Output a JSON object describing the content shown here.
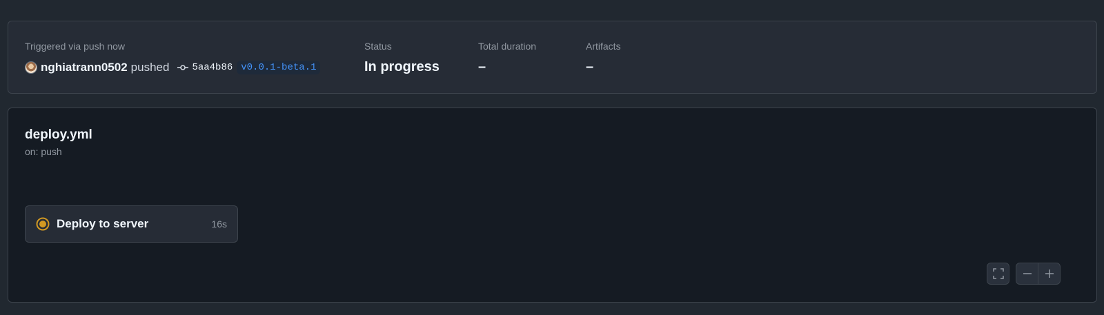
{
  "summary": {
    "trigger_label": "Triggered via push now",
    "user": "nghiatrann0502",
    "action": "pushed",
    "commit_sha": "5aa4b86",
    "tag": "v0.0.1-beta.1",
    "status_label": "Status",
    "status_value": "In progress",
    "duration_label": "Total duration",
    "duration_value": "–",
    "artifacts_label": "Artifacts",
    "artifacts_value": "–"
  },
  "workflow": {
    "name": "deploy.yml",
    "trigger": "on: push"
  },
  "job": {
    "name": "Deploy to server",
    "elapsed": "16s",
    "status_color": "#d29922"
  },
  "controls": {
    "icons": [
      "fullscreen-icon",
      "zoom-out-icon",
      "zoom-in-icon"
    ]
  }
}
